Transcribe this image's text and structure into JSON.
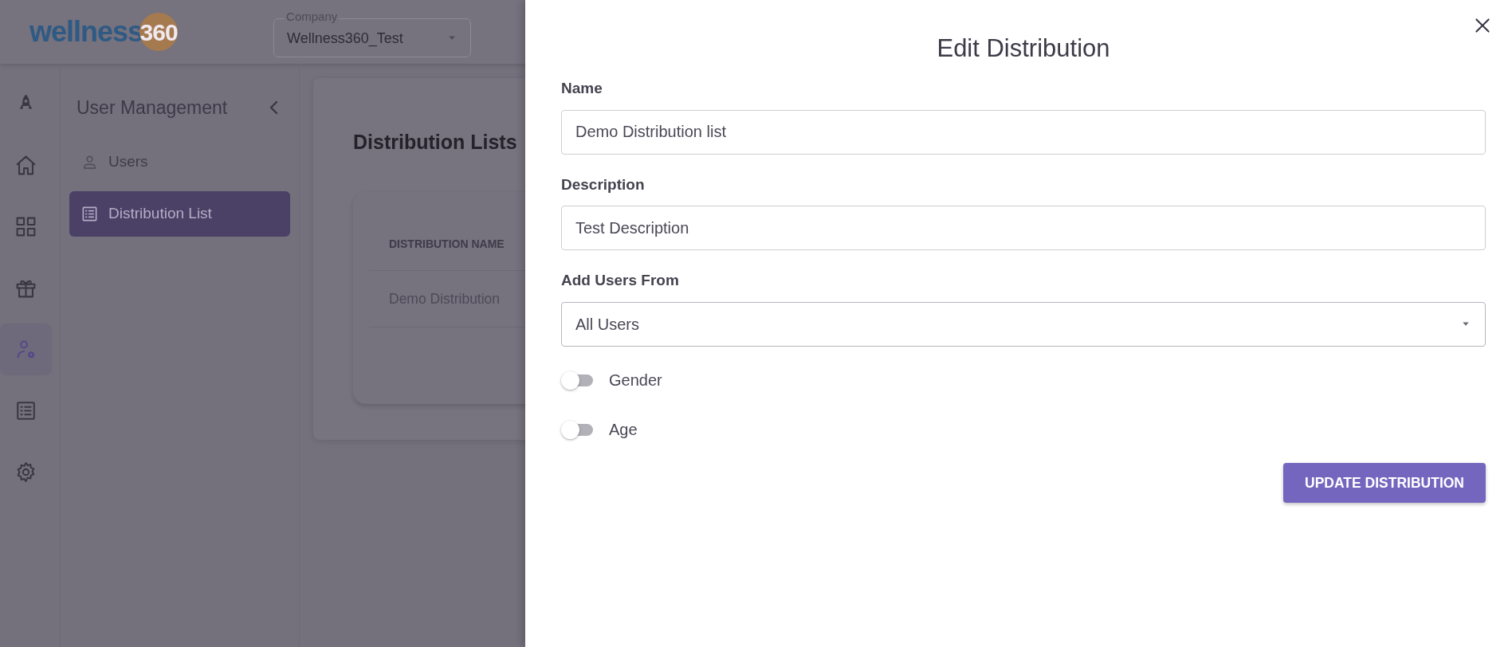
{
  "header": {
    "logo": {
      "word": "wellness",
      "number": "360"
    },
    "company": {
      "label": "Company",
      "value": "Wellness360_Test"
    }
  },
  "rail": [
    {
      "kind": "rocket",
      "selected": false
    },
    {
      "kind": "home",
      "selected": false
    },
    {
      "kind": "grid",
      "selected": false
    },
    {
      "kind": "gift",
      "selected": false
    },
    {
      "kind": "user-gear",
      "selected": true
    },
    {
      "kind": "list",
      "selected": false
    },
    {
      "kind": "gear",
      "selected": false
    }
  ],
  "sidebar": {
    "title": "User Management",
    "items": [
      {
        "label": "Users",
        "kind": "user",
        "selected": false
      },
      {
        "label": "Distribution List",
        "kind": "list",
        "selected": true
      }
    ]
  },
  "content": {
    "title": "Distribution Lists",
    "table": {
      "columns": [
        "DISTRIBUTION NAME"
      ],
      "rows": [
        [
          "Demo Distribution"
        ]
      ]
    }
  },
  "drawer": {
    "title": "Edit Distribution",
    "fields": [
      {
        "label": "Name",
        "kind": "text",
        "value": "Demo Distribution list"
      },
      {
        "label": "Description",
        "kind": "text",
        "value": "Test Description"
      },
      {
        "label": "Add Users From",
        "kind": "select",
        "value": "All Users"
      }
    ],
    "toggles": [
      {
        "label": "Gender",
        "on": false
      },
      {
        "label": "Age",
        "on": false
      }
    ],
    "button": "UPDATE DISTRIBUTION"
  }
}
